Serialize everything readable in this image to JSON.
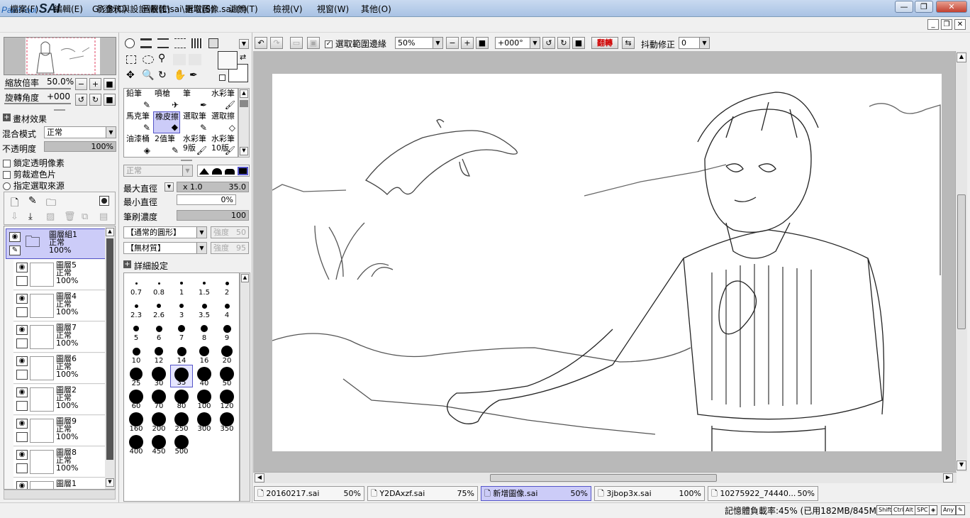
{
  "app": {
    "logo": "PaintTool",
    "logo_sai": "SAI",
    "title": "G:\\塗鴉與設計\\軟體\\sai\\新增圖像.sai (*)"
  },
  "window": {
    "minimize": "—",
    "restore": "❐",
    "close": "✕"
  },
  "menu": [
    "檔案(F)",
    "編輯(E)",
    "影像(C)",
    "圖層(L)",
    "選取(S)",
    "濾鏡(T)",
    "檢視(V)",
    "視窗(W)",
    "其他(O)"
  ],
  "navigator": {
    "zoom_label": "縮放倍率",
    "zoom_value": "50.0%",
    "rotate_label": "旋轉角度",
    "rotate_value": "+000"
  },
  "effects": {
    "header": "畫材效果",
    "blend_label": "混合模式",
    "blend_value": "正常",
    "opacity_label": "不透明度",
    "opacity_value": "100%"
  },
  "layer_options": {
    "lock_alpha": "鎖定透明像素",
    "clip": "剪裁遮色片",
    "selection_source": "指定選取來源"
  },
  "layers": [
    {
      "name": "圖層組1",
      "mode": "正常",
      "opacity": "100%",
      "group": true
    },
    {
      "name": "圖層5",
      "mode": "正常",
      "opacity": "100%"
    },
    {
      "name": "圖層4",
      "mode": "正常",
      "opacity": "100%"
    },
    {
      "name": "圖層7",
      "mode": "正常",
      "opacity": "100%"
    },
    {
      "name": "圖層6",
      "mode": "正常",
      "opacity": "100%"
    },
    {
      "name": "圖層2",
      "mode": "正常",
      "opacity": "100%"
    },
    {
      "name": "圖層9",
      "mode": "正常",
      "opacity": "100%"
    },
    {
      "name": "圖層8",
      "mode": "正常",
      "opacity": "100%"
    },
    {
      "name": "圖層1",
      "mode": "",
      "opacity": ""
    }
  ],
  "tools": [
    "鉛筆",
    "噴槍",
    "筆",
    "水彩筆",
    "馬克筆",
    "橡皮擦",
    "選取筆",
    "選取擦",
    "油漆桶",
    "2值筆",
    "水彩筆9版",
    "水彩筆10版"
  ],
  "brush": {
    "mode_value": "正常",
    "max_size_label": "最大直徑",
    "max_size_mult": "x 1.0",
    "max_size_value": "35.0",
    "min_size_label": "最小直徑",
    "min_size_value": "0%",
    "density_label": "筆刷濃度",
    "density_value": "100",
    "shape_value": "【通常的圓形】",
    "shape_strength_label": "強度",
    "shape_strength_value": "50",
    "texture_value": "【無材質】",
    "texture_strength_label": "強度",
    "texture_strength_value": "95",
    "detail_label": "詳細設定"
  },
  "brush_sizes": [
    "0.7",
    "0.8",
    "1",
    "1.5",
    "2",
    "2.3",
    "2.6",
    "3",
    "3.5",
    "4",
    "5",
    "6",
    "7",
    "8",
    "9",
    "10",
    "12",
    "14",
    "16",
    "20",
    "25",
    "30",
    "35",
    "40",
    "50",
    "60",
    "70",
    "80",
    "100",
    "120",
    "160",
    "200",
    "250",
    "300",
    "350",
    "400",
    "450",
    "500"
  ],
  "toolbar": {
    "selection_edge_label": "選取範圍邊緣",
    "zoom_value": "50%",
    "angle_value": "+000°",
    "flip_label": "翻轉",
    "stabilizer_label": "抖動修正",
    "stabilizer_value": "0"
  },
  "tabs": [
    {
      "name": "20160217.sai",
      "zoom": "50%"
    },
    {
      "name": "Y2DAxzf.sai",
      "zoom": "75%"
    },
    {
      "name": "新增圖像.sai",
      "zoom": "50%",
      "active": true
    },
    {
      "name": "3jbop3x.sai",
      "zoom": "100%"
    },
    {
      "name": "10275922_74440...",
      "zoom": "50%"
    }
  ],
  "status": {
    "memory": "記憶體負載率:45% (已用182MB/845MB)",
    "keys": [
      "Shift",
      "Ctrl",
      "Alt",
      "SPC",
      "◈",
      "Any",
      "✎"
    ]
  },
  "colors": {
    "selection": "#ccccf8",
    "selection_border": "#5555c8",
    "flip_text": "#d00000",
    "canvas_bg": "#b9b9b9"
  }
}
